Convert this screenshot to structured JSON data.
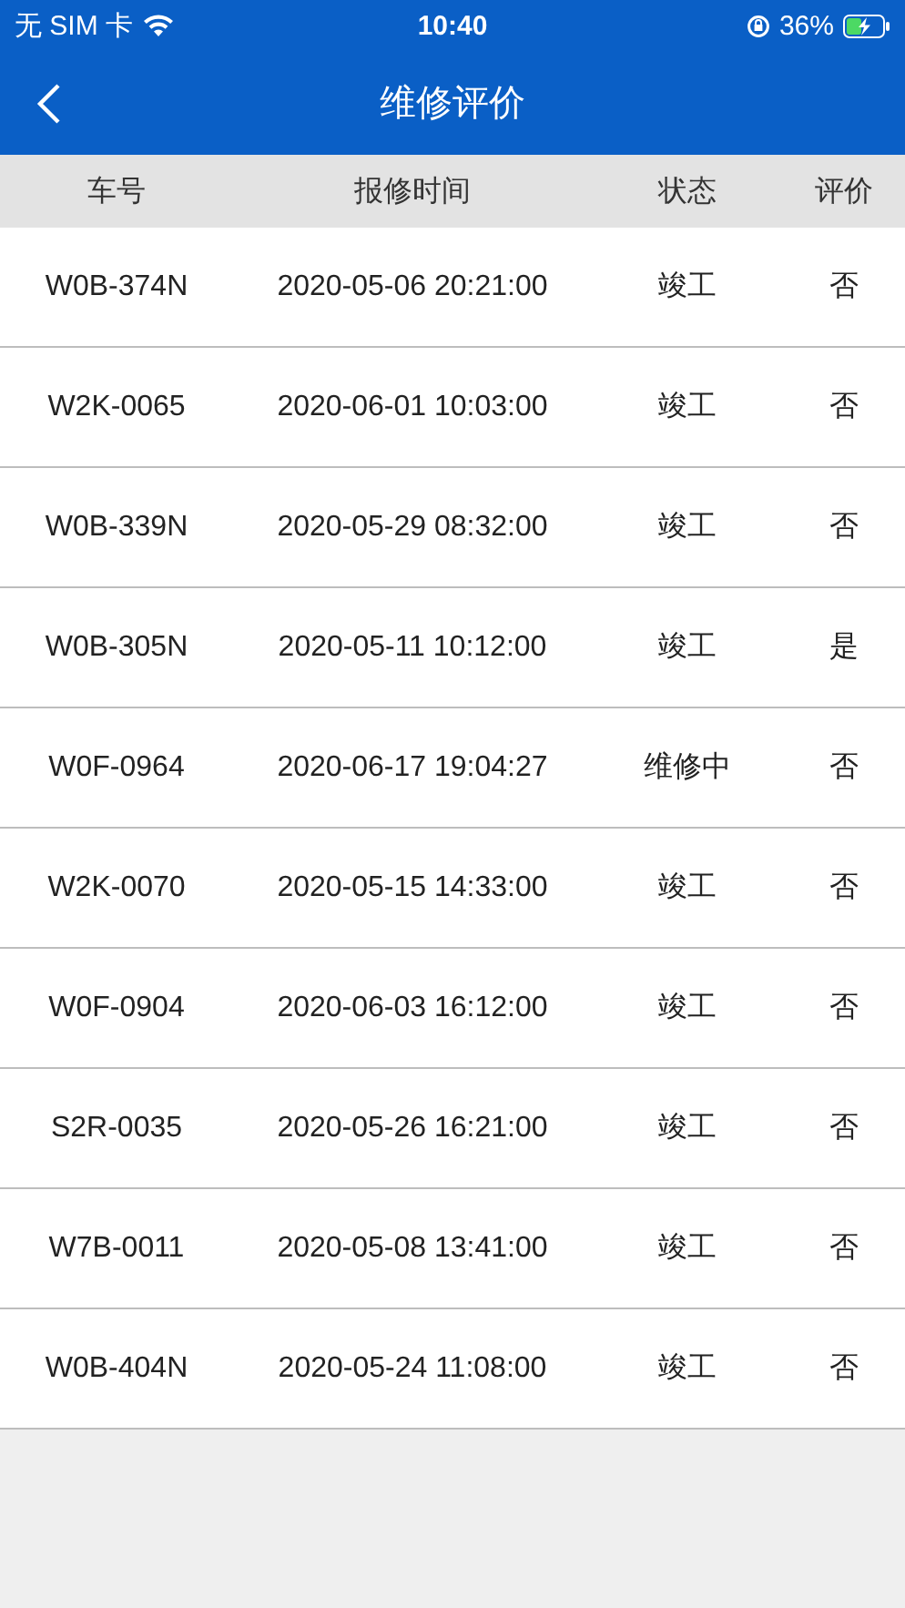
{
  "status_bar": {
    "carrier": "无 SIM 卡",
    "time": "10:40",
    "battery": "36%"
  },
  "nav": {
    "title": "维修评价"
  },
  "table": {
    "columns": [
      "车号",
      "报修时间",
      "状态",
      "评价"
    ],
    "rows": [
      [
        "W0B-374N",
        "2020-05-06 20:21:00",
        "竣工",
        "否"
      ],
      [
        "W2K-0065",
        "2020-06-01 10:03:00",
        "竣工",
        "否"
      ],
      [
        "W0B-339N",
        "2020-05-29 08:32:00",
        "竣工",
        "否"
      ],
      [
        "W0B-305N",
        "2020-05-11 10:12:00",
        "竣工",
        "是"
      ],
      [
        "W0F-0964",
        "2020-06-17 19:04:27",
        "维修中",
        "否"
      ],
      [
        "W2K-0070",
        "2020-05-15 14:33:00",
        "竣工",
        "否"
      ],
      [
        "W0F-0904",
        "2020-06-03 16:12:00",
        "竣工",
        "否"
      ],
      [
        "S2R-0035",
        "2020-05-26 16:21:00",
        "竣工",
        "否"
      ],
      [
        "W7B-0011",
        "2020-05-08 13:41:00",
        "竣工",
        "否"
      ],
      [
        "W0B-404N",
        "2020-05-24 11:08:00",
        "竣工",
        "否"
      ]
    ]
  }
}
